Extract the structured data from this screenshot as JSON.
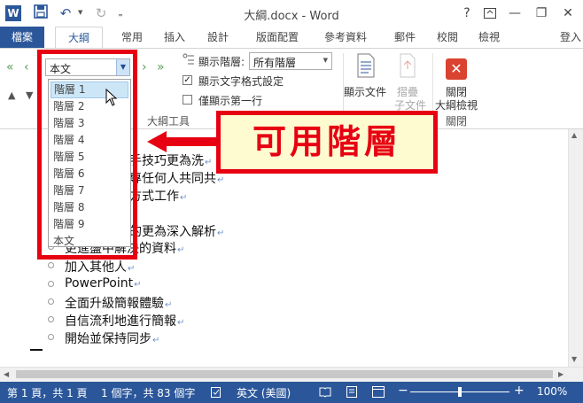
{
  "window": {
    "title": "大綱.docx - Word",
    "help": "?",
    "minimize": "—",
    "restore": "❐",
    "close": "✕"
  },
  "qat": {
    "word_icon": "W",
    "save_icon": "save-icon",
    "undo": "↶",
    "redo": "↻"
  },
  "tabs": {
    "file": "檔案",
    "items": [
      "大綱",
      "常用",
      "插入",
      "設計",
      "版面配置",
      "參考資料",
      "郵件",
      "校閱",
      "檢視"
    ],
    "signin": "登入"
  },
  "ribbon": {
    "level_combo_value": "本文",
    "show_level_label": "顯示階層:",
    "show_level_value": "所有階層",
    "show_text_formatting": "顯示文字格式設定",
    "show_text_formatting_checked": true,
    "show_first_line_only": "僅顯示第一行",
    "outline_tools_group": "大綱工具",
    "show_document": "顯示文件",
    "collapse_subdoc": "摺疊",
    "collapse_subdoc_sub": "子文件",
    "close_outline_1": "關閉",
    "close_outline_2": "大綱檢視",
    "close_group": "關閉"
  },
  "dropdown": {
    "options": [
      "階層 1",
      "階層 2",
      "階層 3",
      "階層 4",
      "階層 5",
      "階層 6",
      "階層 7",
      "階層 8",
      "階層 9",
      "本文"
    ],
    "selected": "階層 1"
  },
  "document": {
    "lines": [
      "手技巧更為洗",
      "專任何人共同共",
      "方式工作",
      "",
      "的更為深入解析",
      "更進盪中解決的資料",
      "加入其他人",
      "PowerPoint",
      "全面升級簡報體驗",
      "自信流利地進行簡報",
      "開始並保持同步"
    ],
    "paragraph_mark": "↵"
  },
  "annotation": {
    "callout": "可用階層"
  },
  "statusbar": {
    "page": "第 1 頁，共 1 頁",
    "words": "1 個字，共 83 個字",
    "language": "英文 (美國)",
    "zoom": "100%"
  },
  "colors": {
    "accent": "#2b579a",
    "annotation": "#e60012",
    "callout_bg": "#fffbd0"
  }
}
